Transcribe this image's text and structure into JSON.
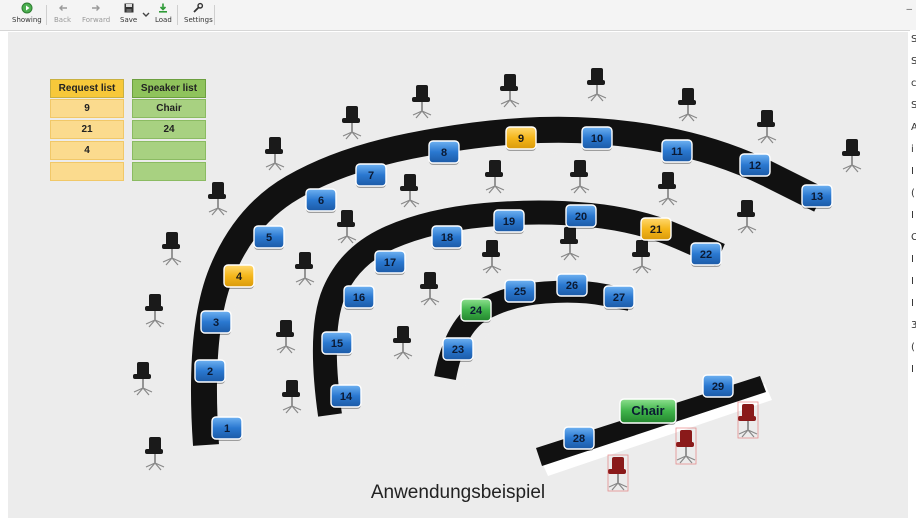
{
  "toolbar": {
    "showing": "Showing",
    "back": "Back",
    "forward": "Forward",
    "save": "Save",
    "load": "Load",
    "settings": "Settings"
  },
  "request_list": {
    "header": "Request list",
    "items": [
      "9",
      "21",
      "4",
      ""
    ]
  },
  "speaker_list": {
    "header": "Speaker list",
    "items": [
      "Chair",
      "24",
      "",
      ""
    ]
  },
  "seats": [
    {
      "label": "1",
      "state": "idle"
    },
    {
      "label": "2",
      "state": "idle"
    },
    {
      "label": "3",
      "state": "idle"
    },
    {
      "label": "4",
      "state": "request"
    },
    {
      "label": "5",
      "state": "idle"
    },
    {
      "label": "6",
      "state": "idle"
    },
    {
      "label": "7",
      "state": "idle"
    },
    {
      "label": "8",
      "state": "idle"
    },
    {
      "label": "9",
      "state": "request"
    },
    {
      "label": "10",
      "state": "idle"
    },
    {
      "label": "11",
      "state": "idle"
    },
    {
      "label": "12",
      "state": "idle"
    },
    {
      "label": "13",
      "state": "idle"
    },
    {
      "label": "14",
      "state": "idle"
    },
    {
      "label": "15",
      "state": "idle"
    },
    {
      "label": "16",
      "state": "idle"
    },
    {
      "label": "17",
      "state": "idle"
    },
    {
      "label": "18",
      "state": "idle"
    },
    {
      "label": "19",
      "state": "idle"
    },
    {
      "label": "20",
      "state": "idle"
    },
    {
      "label": "21",
      "state": "request"
    },
    {
      "label": "22",
      "state": "idle"
    },
    {
      "label": "23",
      "state": "idle"
    },
    {
      "label": "24",
      "state": "speaking"
    },
    {
      "label": "25",
      "state": "idle"
    },
    {
      "label": "26",
      "state": "idle"
    },
    {
      "label": "27",
      "state": "idle"
    },
    {
      "label": "28",
      "state": "idle"
    },
    {
      "label": "Chair",
      "state": "speaking"
    },
    {
      "label": "29",
      "state": "idle"
    }
  ],
  "edge_text": [
    "S",
    "S",
    "c",
    "S",
    "A",
    "i",
    "I",
    "(",
    "I",
    "C",
    "I",
    "I",
    "I",
    "3",
    "(",
    "I"
  ],
  "colors": {
    "idle": "#2a78d0",
    "request": "#f5b61b",
    "speaking": "#3fb34a",
    "desk": "#111111"
  },
  "icons": {
    "showing": "play-circle-icon",
    "back": "arrow-left-icon",
    "forward": "arrow-right-icon",
    "save": "floppy-icon",
    "load": "download-icon",
    "settings": "wrench-icon",
    "chair": "office-chair-icon"
  },
  "caption": "Anwendungsbeispiel"
}
